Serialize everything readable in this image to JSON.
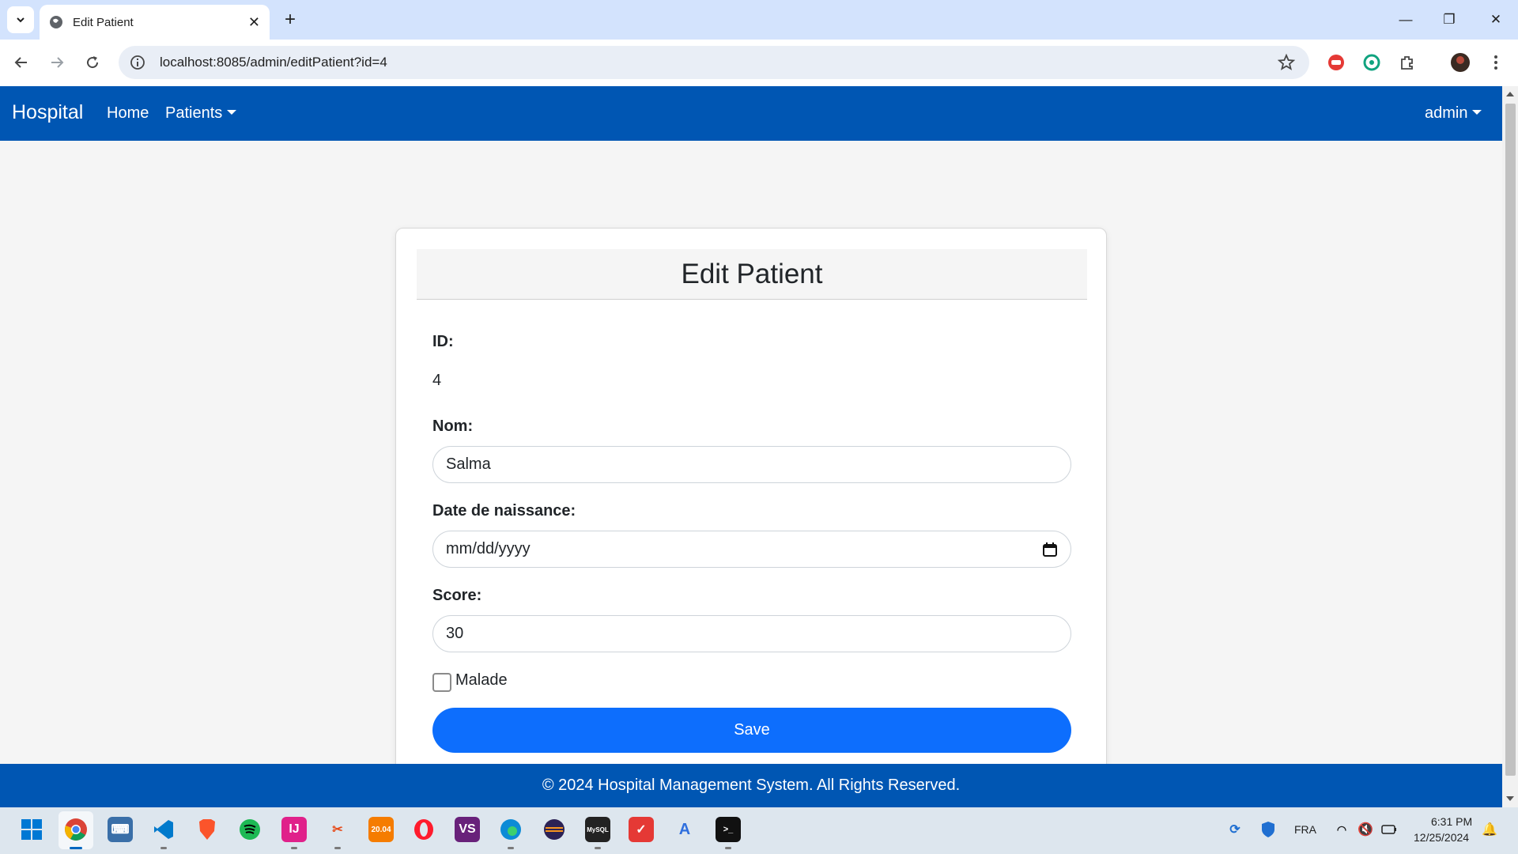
{
  "browser": {
    "tab_title": "Edit Patient",
    "url": "localhost:8085/admin/editPatient?id=4"
  },
  "navbar": {
    "brand": "Hospital",
    "links": [
      "Home",
      "Patients"
    ],
    "user": "admin"
  },
  "form": {
    "title": "Edit Patient",
    "id_label": "ID:",
    "id_value": "4",
    "nom_label": "Nom:",
    "nom_value": "Salma",
    "date_label": "Date de naissance:",
    "date_placeholder": "mm/dd/yyyy",
    "score_label": "Score:",
    "score_value": "30",
    "malade_label": "Malade",
    "malade_checked": false,
    "save_label": "Save"
  },
  "footer": {
    "text": "© 2024 Hospital Management System. All Rights Reserved."
  },
  "taskbar": {
    "language": "FRA",
    "time": "6:31 PM",
    "date": "12/25/2024"
  },
  "colors": {
    "navbar": "#0056b3",
    "primary_button": "#0d6efd",
    "tabstrip": "#d3e3fd"
  }
}
